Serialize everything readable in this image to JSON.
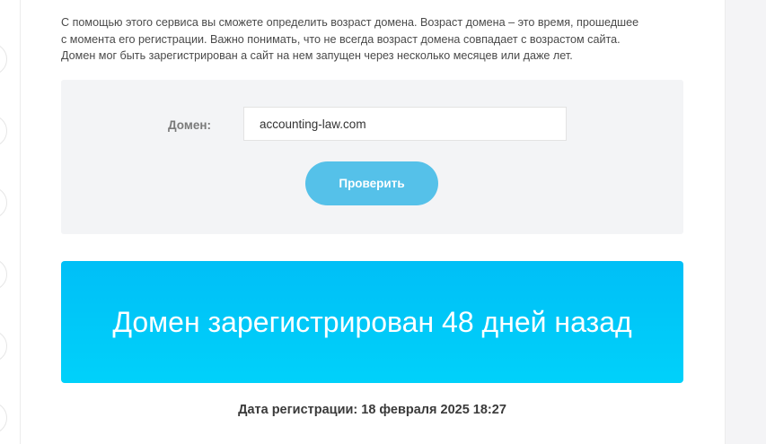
{
  "intro": {
    "line1": "С помощью этого сервиса вы сможете определить возраст домена. Возраст домена – это время, прошедшее",
    "line2": "с момента его регистрации. Важно понимать, что не всегда возраст домена совпадает с возрастом сайта.",
    "line3": "Домен мог быть зарегистрирован а сайт на нем запущен через несколько месяцев или даже лет."
  },
  "form": {
    "domain_label": "Домен:",
    "domain_value": "accounting-law.com",
    "submit_label": "Проверить"
  },
  "result": {
    "message": "Домен зарегистрирован 48 дней назад",
    "registration_date": "Дата регистрации: 18 февраля 2025 18:27"
  },
  "colors": {
    "accent_button": "#55c1e9",
    "banner": "#00c6f8"
  }
}
